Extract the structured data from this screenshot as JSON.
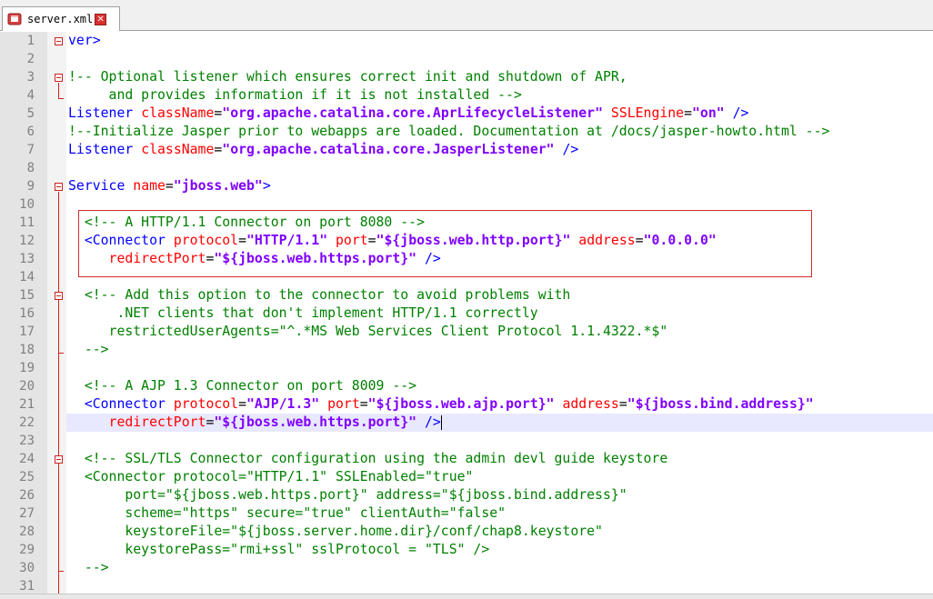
{
  "tab": {
    "filename": "server.xml",
    "file_icon": "xml-file-icon",
    "close_icon": "close-icon"
  },
  "lines": [
    {
      "n": "1",
      "parts": [
        {
          "t": "ver>",
          "c": "tag"
        }
      ]
    },
    {
      "n": "2",
      "parts": []
    },
    {
      "n": "3",
      "parts": [
        {
          "t": "!-- Optional listener which ensures correct init and shutdown of APR,",
          "c": "cmt"
        }
      ]
    },
    {
      "n": "4",
      "parts": [
        {
          "t": "     and provides information if it is not installed -->",
          "c": "cmt"
        }
      ]
    },
    {
      "n": "5",
      "parts": [
        {
          "t": "Listener ",
          "c": "tag"
        },
        {
          "t": "className",
          "c": "attr"
        },
        {
          "t": "=",
          "c": "eq"
        },
        {
          "t": "\"org.apache.catalina.core.AprLifecycleListener\"",
          "c": "val"
        },
        {
          "t": " SSLEngine",
          "c": "attr"
        },
        {
          "t": "=",
          "c": "eq"
        },
        {
          "t": "\"on\"",
          "c": "val"
        },
        {
          "t": " />",
          "c": "tag"
        }
      ]
    },
    {
      "n": "6",
      "parts": [
        {
          "t": "!--Initialize Jasper prior to webapps are loaded. Documentation at /docs/jasper-howto.html -->",
          "c": "cmt"
        }
      ]
    },
    {
      "n": "7",
      "parts": [
        {
          "t": "Listener ",
          "c": "tag"
        },
        {
          "t": "className",
          "c": "attr"
        },
        {
          "t": "=",
          "c": "eq"
        },
        {
          "t": "\"org.apache.catalina.core.JasperListener\"",
          "c": "val"
        },
        {
          "t": " />",
          "c": "tag"
        }
      ]
    },
    {
      "n": "8",
      "parts": []
    },
    {
      "n": "9",
      "parts": [
        {
          "t": "Service ",
          "c": "tag"
        },
        {
          "t": "name",
          "c": "attr"
        },
        {
          "t": "=",
          "c": "eq"
        },
        {
          "t": "\"jboss.web\"",
          "c": "val"
        },
        {
          "t": ">",
          "c": "tag"
        }
      ]
    },
    {
      "n": "10",
      "parts": []
    },
    {
      "n": "11",
      "parts": [
        {
          "t": "  <!-- A HTTP/1.1 Connector on port 8080 -->",
          "c": "cmt"
        }
      ]
    },
    {
      "n": "12",
      "parts": [
        {
          "t": "  <Connector ",
          "c": "tag"
        },
        {
          "t": "protocol",
          "c": "attr"
        },
        {
          "t": "=",
          "c": "eq"
        },
        {
          "t": "\"HTTP/1.1\"",
          "c": "val"
        },
        {
          "t": " port",
          "c": "attr"
        },
        {
          "t": "=",
          "c": "eq"
        },
        {
          "t": "\"${jboss.web.http.port}\"",
          "c": "val"
        },
        {
          "t": " address",
          "c": "attr"
        },
        {
          "t": "=",
          "c": "eq"
        },
        {
          "t": "\"0.0.0.0\"",
          "c": "val"
        }
      ]
    },
    {
      "n": "13",
      "parts": [
        {
          "t": "     redirectPort",
          "c": "attr"
        },
        {
          "t": "=",
          "c": "eq"
        },
        {
          "t": "\"${jboss.web.https.port}\"",
          "c": "val"
        },
        {
          "t": " />",
          "c": "tag"
        }
      ]
    },
    {
      "n": "14",
      "parts": []
    },
    {
      "n": "15",
      "parts": [
        {
          "t": "  <!-- Add this option to the connector to avoid problems with",
          "c": "cmt"
        }
      ]
    },
    {
      "n": "16",
      "parts": [
        {
          "t": "      .NET clients that don't implement HTTP/1.1 correctly",
          "c": "cmt"
        }
      ]
    },
    {
      "n": "17",
      "parts": [
        {
          "t": "     restrictedUserAgents=\"^.*MS Web Services Client Protocol 1.1.4322.*$\"",
          "c": "cmt"
        }
      ]
    },
    {
      "n": "18",
      "parts": [
        {
          "t": "  -->",
          "c": "cmt"
        }
      ]
    },
    {
      "n": "19",
      "parts": []
    },
    {
      "n": "20",
      "parts": [
        {
          "t": "  <!-- A AJP 1.3 Connector on port 8009 -->",
          "c": "cmt"
        }
      ]
    },
    {
      "n": "21",
      "parts": [
        {
          "t": "  <Connector ",
          "c": "tag"
        },
        {
          "t": "protocol",
          "c": "attr"
        },
        {
          "t": "=",
          "c": "eq"
        },
        {
          "t": "\"AJP/1.3\"",
          "c": "val"
        },
        {
          "t": " port",
          "c": "attr"
        },
        {
          "t": "=",
          "c": "eq"
        },
        {
          "t": "\"${jboss.web.ajp.port}\"",
          "c": "val"
        },
        {
          "t": " address",
          "c": "attr"
        },
        {
          "t": "=",
          "c": "eq"
        },
        {
          "t": "\"${jboss.bind.address}\"",
          "c": "val"
        }
      ]
    },
    {
      "n": "22",
      "parts": [
        {
          "t": "     redirectPort",
          "c": "attr"
        },
        {
          "t": "=",
          "c": "eq"
        },
        {
          "t": "\"${jboss.web.https.port}\"",
          "c": "val"
        },
        {
          "t": " />",
          "c": "tag"
        }
      ],
      "caret": true
    },
    {
      "n": "23",
      "parts": []
    },
    {
      "n": "24",
      "parts": [
        {
          "t": "  <!-- SSL/TLS Connector configuration using the admin devl guide keystore",
          "c": "cmt"
        }
      ]
    },
    {
      "n": "25",
      "parts": [
        {
          "t": "  <Connector protocol=\"HTTP/1.1\" SSLEnabled=\"true\"",
          "c": "cmt"
        }
      ]
    },
    {
      "n": "26",
      "parts": [
        {
          "t": "       port=\"${jboss.web.https.port}\" address=\"${jboss.bind.address}\"",
          "c": "cmt"
        }
      ]
    },
    {
      "n": "27",
      "parts": [
        {
          "t": "       scheme=\"https\" secure=\"true\" clientAuth=\"false\"",
          "c": "cmt"
        }
      ]
    },
    {
      "n": "28",
      "parts": [
        {
          "t": "       keystoreFile=\"${jboss.server.home.dir}/conf/chap8.keystore\"",
          "c": "cmt"
        }
      ]
    },
    {
      "n": "29",
      "parts": [
        {
          "t": "       keystorePass=\"rmi+ssl\" sslProtocol = \"TLS\" />",
          "c": "cmt"
        }
      ]
    },
    {
      "n": "30",
      "parts": [
        {
          "t": "  -->",
          "c": "cmt"
        }
      ]
    },
    {
      "n": "31",
      "parts": []
    }
  ]
}
